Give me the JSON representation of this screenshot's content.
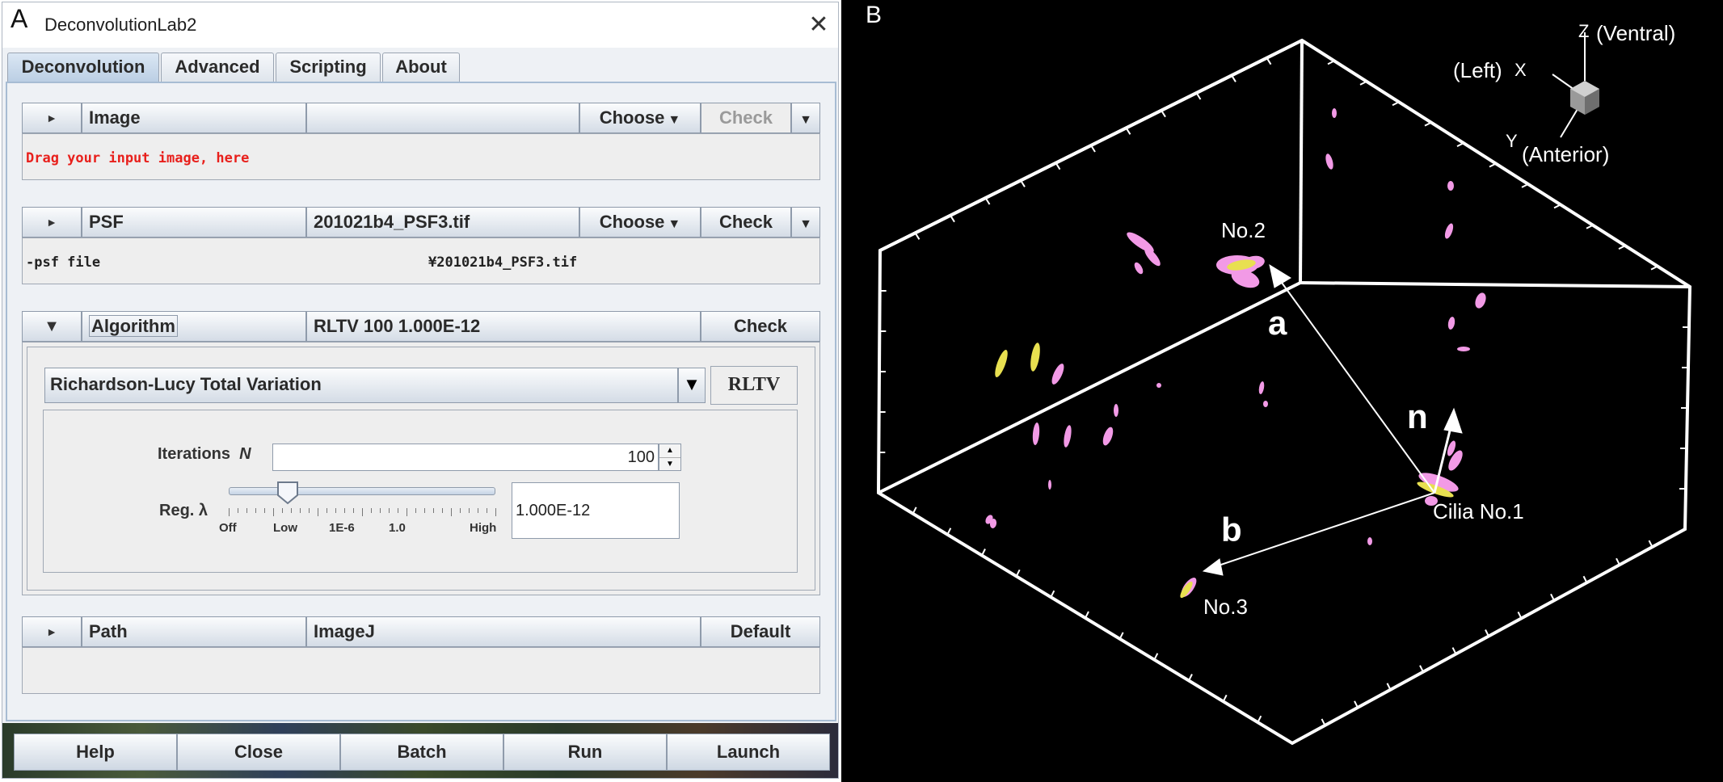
{
  "panel_a": {
    "letter": "A",
    "window_title": "DeconvolutionLab2",
    "tabs": [
      {
        "label": "Deconvolution"
      },
      {
        "label": "Advanced"
      },
      {
        "label": "Scripting"
      },
      {
        "label": "About"
      }
    ],
    "image_section": {
      "header": "Image",
      "value": "",
      "choose": "Choose",
      "check": "Check",
      "hint": "Drag your input image, here"
    },
    "psf_section": {
      "header": "PSF",
      "value": "201021b4_PSF3.tif",
      "choose": "Choose",
      "check": "Check",
      "row_key": "-psf file",
      "row_value": "¥201021b4_PSF3.tif"
    },
    "algorithm_section": {
      "header": "Algorithm",
      "value": "RLTV 100 1.000E-12",
      "check": "Check",
      "selected": "Richardson-Lucy Total Variation",
      "short": "RLTV",
      "iterations_label": "Iterations",
      "iterations_symbol": "N",
      "iterations_value": "100",
      "reg_label": "Reg. λ",
      "reg_value": "1.000E-12",
      "slider_ticks": [
        "Off",
        "Low",
        "1E-6",
        "1.0",
        "High"
      ],
      "slider_level": 0.22
    },
    "path_section": {
      "header": "Path",
      "value": "ImageJ",
      "default": "Default"
    },
    "buttons": [
      "Help",
      "Close",
      "Batch",
      "Run",
      "Launch"
    ]
  },
  "panel_b": {
    "letter": "B",
    "axes": {
      "z": "Z",
      "z_dir": "(Ventral)",
      "x": "X",
      "x_dir": "(Left)",
      "y": "Y",
      "y_dir": "(Anterior)"
    },
    "labels": {
      "no2": "No.2",
      "no3": "No.3",
      "cilia1": "Cilia No.1",
      "a": "a",
      "b": "b",
      "n": "n"
    },
    "colors": {
      "background": "#000000",
      "box": "#ffffff",
      "cilia_pink": "#f29ae6",
      "cilia_yellow": "#e8e050"
    }
  }
}
